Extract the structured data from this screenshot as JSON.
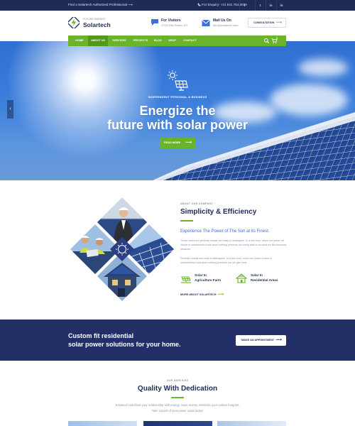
{
  "topbar": {
    "notice": "Find a Solartech Authorized Professional",
    "enquiry": "For Enquiry: +31 541 754 3010",
    "social": [
      "f",
      "t",
      "in",
      "in"
    ]
  },
  "header": {
    "logo_tagline": "FUTURE ENERGY",
    "logo_name": "Solartech",
    "visitors_title": "For Visitors",
    "visitors_sub": "4718 13th Street, NY",
    "mail_title": "Mail Us On",
    "mail_sub": "info@solartech.com",
    "consult_label": "CONSULTATION"
  },
  "nav": {
    "items": [
      "HOME",
      "ABOUT US",
      "SERVICES",
      "PROJECTS",
      "BLOG",
      "SHOP",
      "CONTACT"
    ],
    "active_index": 1,
    "cart_count": "0"
  },
  "hero": {
    "kicker": "INDEPENDENT PERSONAL & BUSINESS",
    "title_line1": "Energize the",
    "title_line2": "future with solar power",
    "button": "READ MORE"
  },
  "about": {
    "kicker": "ABOUT OUR COMPANY",
    "title": "Simplicity & Efficiency",
    "lead": "Experience The Power of The Sun at its Finest.",
    "p1": "These cases are perfectly simple and easy to distinguish. In a free hour, when our power off choice is untrammelled and when nothing prevents our being able to do what we like business pleasure.",
    "p2": "Perfectly simple and easy to distinguish. In a free hour, when our power choice is untrammelled and when nothing prevents our we give best.",
    "features": [
      {
        "line1": "Solar In",
        "line2": "Agriculture Farm"
      },
      {
        "line1": "Solar In",
        "line2": "Residential Areas"
      }
    ],
    "more": "MORE ABOUT SOLARTECH"
  },
  "cta": {
    "line1": "Custom fit residential",
    "line2": "solar power solutions for your home.",
    "button": "MAKE AN APPOINTMENT"
  },
  "services": {
    "kicker": "OUR SERVICES",
    "title": "Quality With Dedication",
    "desc1": "Solartech redefines your relationship with energy. Save money. Minimize your carbon footprint.",
    "desc2": "Take control of your power costs today!"
  },
  "colors": {
    "navy": "#1f2a55",
    "green": "#6ab42d",
    "cta_band": "#233067",
    "link_blue": "#3f6fd6"
  }
}
